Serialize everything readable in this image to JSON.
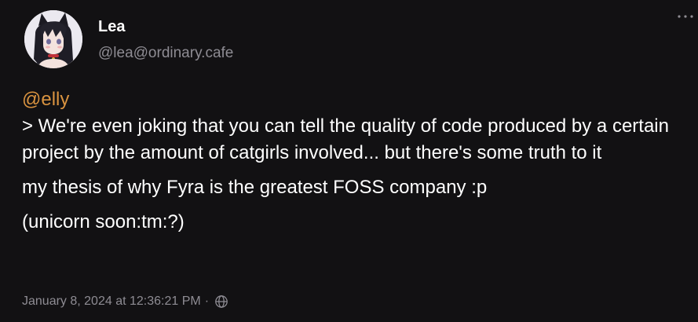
{
  "author": {
    "display_name": "Lea",
    "handle": "@lea@ordinary.cafe",
    "avatar": "avatar-image"
  },
  "post": {
    "mention": "@elly",
    "quote": "> We're even joking that you can tell the quality of code produced by a certain project by the amount of catgirls involved... but there's some truth to it",
    "paragraph_2": "my thesis of why Fyra is the greatest FOSS company :p",
    "paragraph_3": "(unicorn soon:tm:?)"
  },
  "meta": {
    "timestamp": "January 8, 2024 at 12:36:21 PM",
    "separator": "·",
    "visibility_icon": "globe-icon"
  },
  "menu": {
    "icon": "more-horizontal-icon"
  },
  "colors": {
    "background": "#121113",
    "text": "#ffffff",
    "muted": "#8e8c93",
    "mention": "#d99340"
  }
}
